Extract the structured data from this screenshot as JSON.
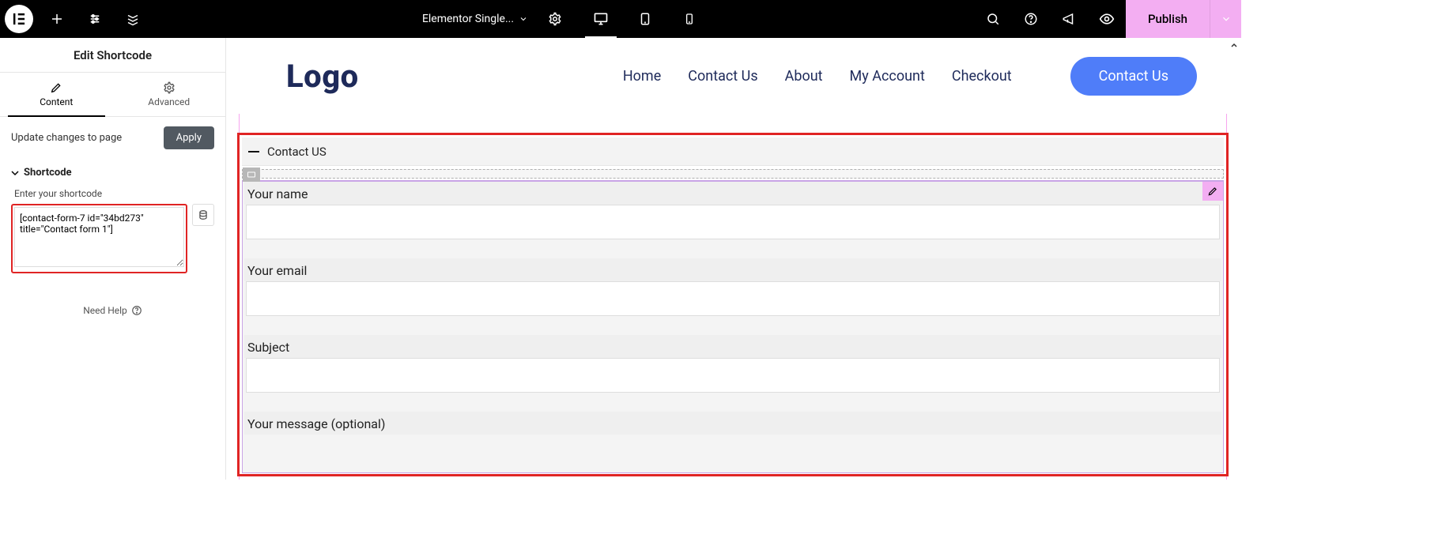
{
  "topbar": {
    "doc_title": "Elementor Single...",
    "publish_label": "Publish"
  },
  "panel": {
    "title": "Edit Shortcode",
    "tabs": {
      "content": "Content",
      "advanced": "Advanced"
    },
    "apply_text": "Update changes to page",
    "apply_btn": "Apply",
    "section": "Shortcode",
    "field_label": "Enter your shortcode",
    "shortcode_value": "[contact-form-7 id=\"34bd273\" title=\"Contact form 1\"]",
    "help": "Need Help"
  },
  "site": {
    "logo": "Logo",
    "nav": [
      "Home",
      "Contact Us",
      "About",
      "My Account",
      "Checkout"
    ],
    "cta": "Contact Us"
  },
  "widget": {
    "toggle_title": "Contact US",
    "form": {
      "name": "Your name",
      "email": "Your email",
      "subject": "Subject",
      "message": "Your message (optional)"
    }
  }
}
